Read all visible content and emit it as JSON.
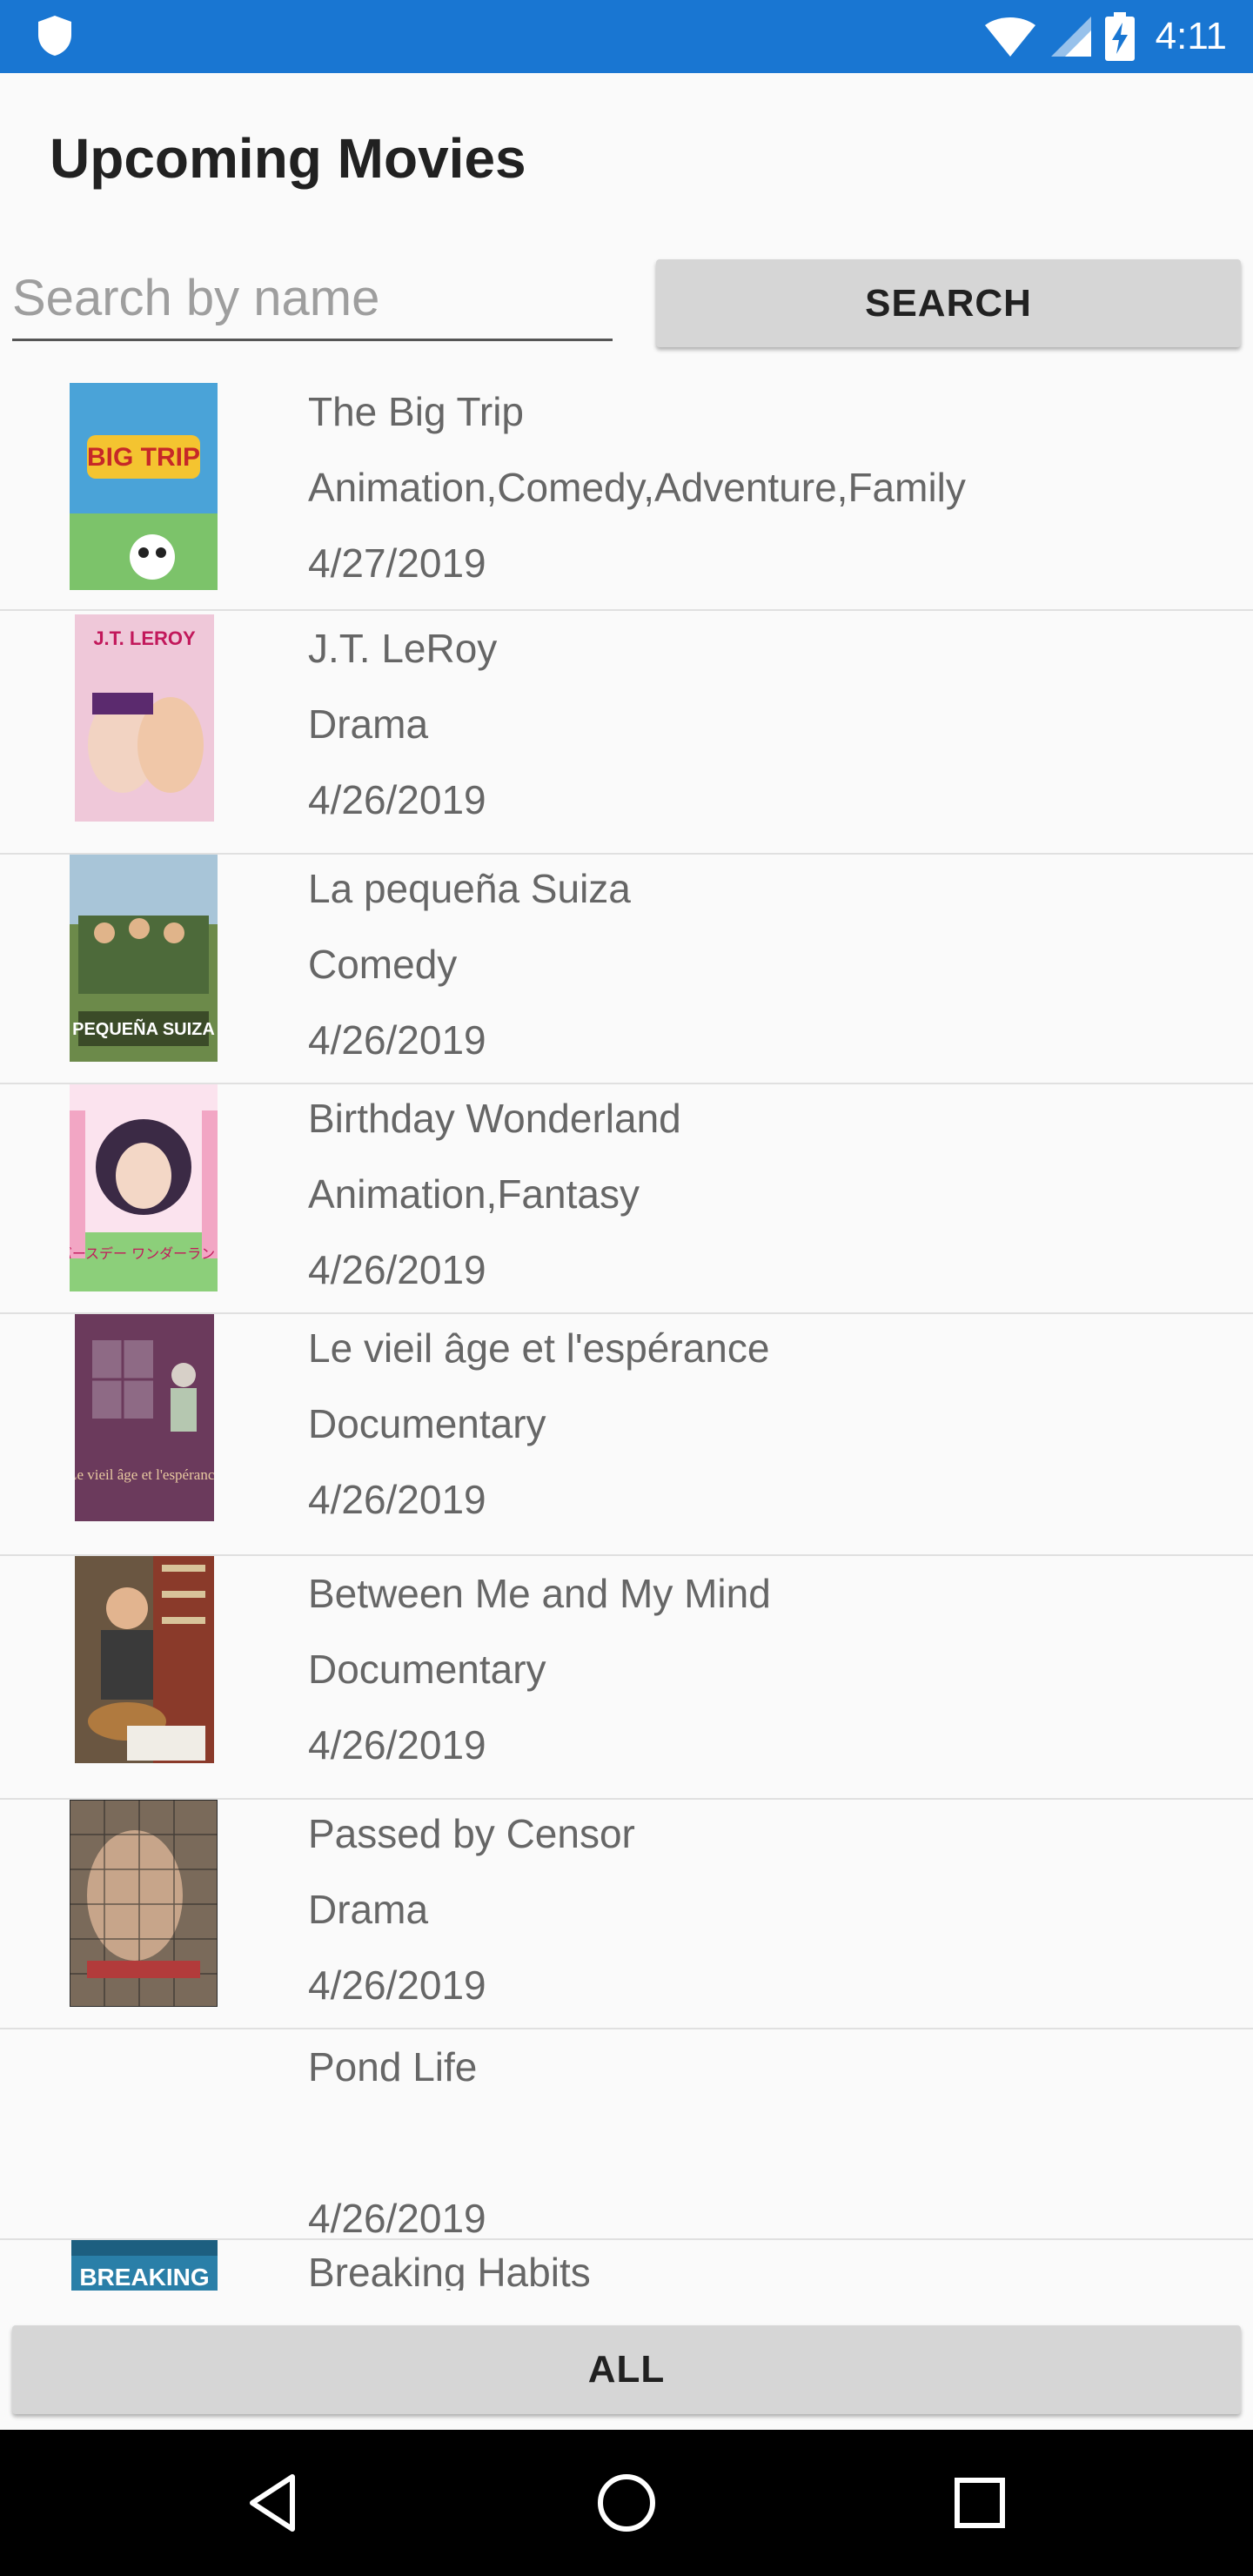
{
  "status_bar": {
    "time": "4:11",
    "background": "#1976d2"
  },
  "header": {
    "title": "Upcoming Movies"
  },
  "search": {
    "placeholder": "Search by name",
    "value": "",
    "button_label": "SEARCH"
  },
  "movies": [
    {
      "title": "The Big Trip",
      "genres": "Animation,Comedy,Adventure,Family",
      "date": "4/27/2019",
      "poster_label": "BIG TRIP",
      "poster_color": "#4aa3d8"
    },
    {
      "title": "J.T. LeRoy",
      "genres": "Drama",
      "date": "4/26/2019",
      "poster_label": "J.T. LEROY",
      "poster_color": "#e78fb3"
    },
    {
      "title": "La pequeña Suiza",
      "genres": "Comedy",
      "date": "4/26/2019",
      "poster_label": "PEQUEÑA SUIZA",
      "poster_color": "#4d6a3a"
    },
    {
      "title": "Birthday Wonderland",
      "genres": "Animation,Fantasy",
      "date": "4/26/2019",
      "poster_label": "バースデー ワンダーランド",
      "poster_color": "#f2a6c4"
    },
    {
      "title": "Le vieil âge et l'espérance",
      "genres": "Documentary",
      "date": "4/26/2019",
      "poster_label": "Le vieil âge et l'espérance",
      "poster_color": "#6b3a5c"
    },
    {
      "title": "Between Me and My Mind",
      "genres": "Documentary",
      "date": "4/26/2019",
      "poster_label": "",
      "poster_color": "#6a5641"
    },
    {
      "title": "Passed by Censor",
      "genres": "Drama",
      "date": "4/26/2019",
      "poster_label": "",
      "poster_color": "#5a4a3a"
    },
    {
      "title": "Pond Life",
      "genres": "",
      "date": "4/26/2019",
      "poster_label": "",
      "poster_color": ""
    },
    {
      "title": "Breaking Habits",
      "genres": "",
      "date": "",
      "poster_label": "BREAKING",
      "poster_color": "#2a7fa8"
    }
  ],
  "all_button": {
    "label": "ALL"
  },
  "nav": {
    "back": "back-icon",
    "home": "home-icon",
    "recents": "recents-icon"
  }
}
